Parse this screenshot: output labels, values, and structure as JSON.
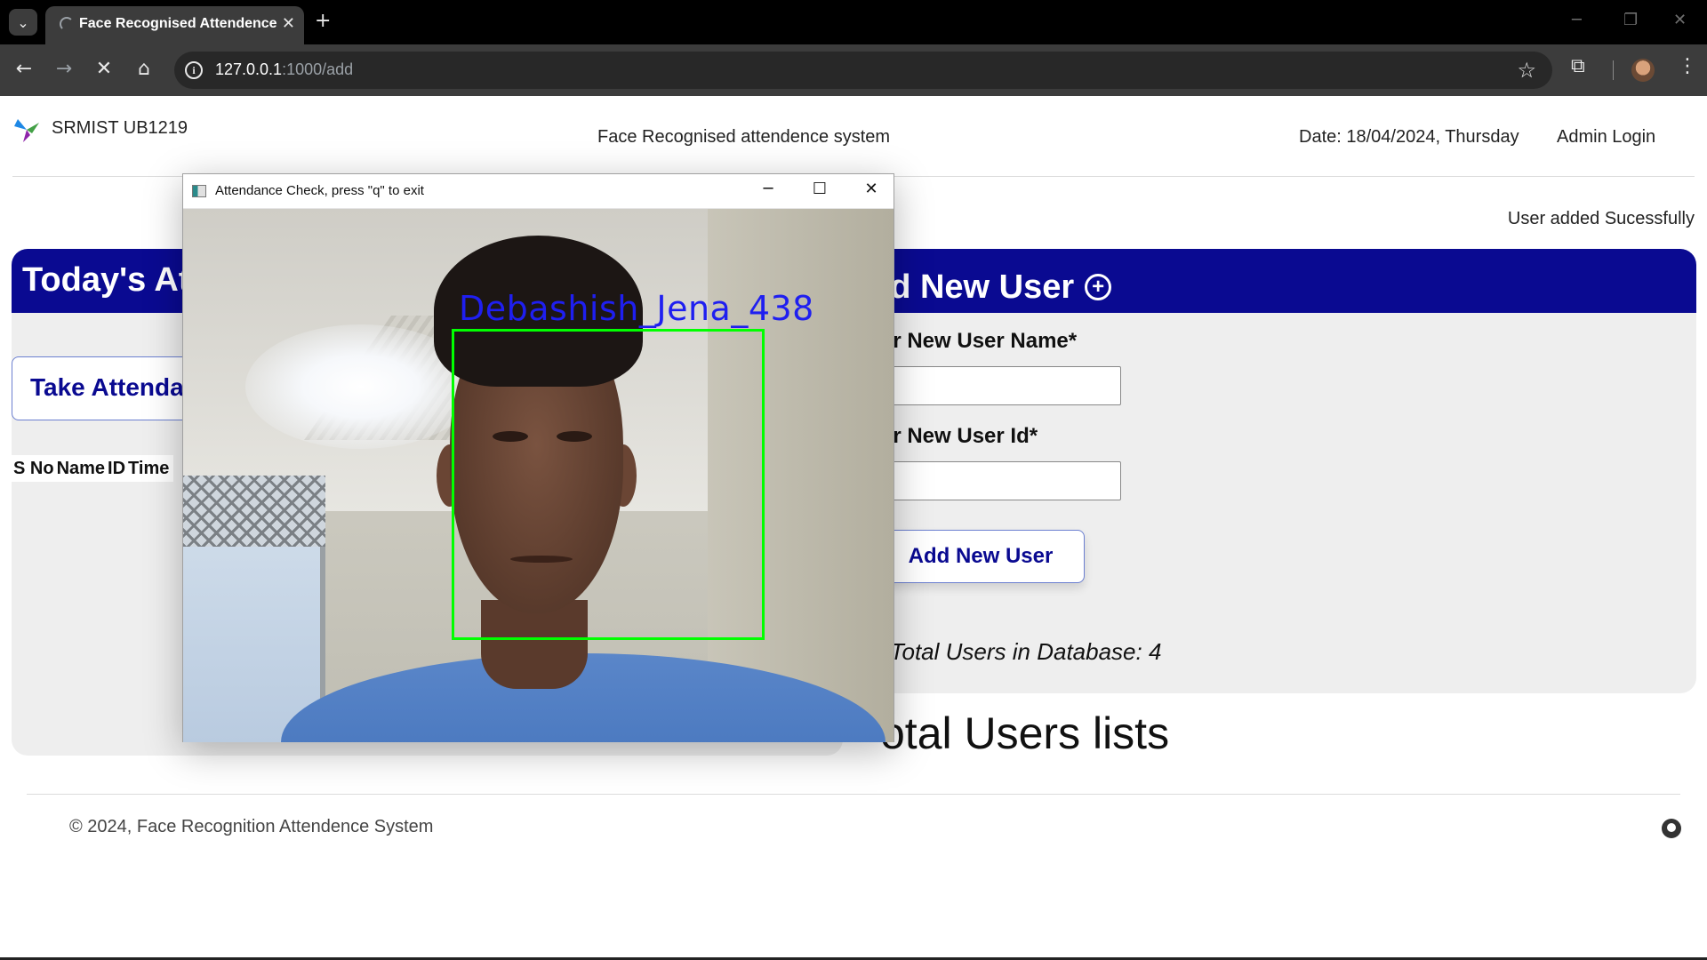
{
  "browser": {
    "tab_title": "Face Recognised Attendence",
    "url_host": "127.0.0.1",
    "url_rest": ":1000/add",
    "icons": {
      "tab_search": "chevron-down-icon",
      "close_tab": "close-icon",
      "new_tab": "plus-icon",
      "back": "arrow-left-icon",
      "forward": "arrow-right-icon",
      "stop": "close-icon",
      "home": "home-icon",
      "site_info": "info-icon",
      "bookmark": "star-icon",
      "extensions": "puzzle-icon",
      "profile": "avatar",
      "menu": "kebab-icon"
    }
  },
  "header": {
    "brand": "SRMIST UB1219",
    "title": "Face Recognised attendence system",
    "date": "Date: 18/04/2024, Thursday",
    "admin_link": "Admin Login"
  },
  "status_message": "User added Sucessfully",
  "attendance_panel": {
    "heading": "Today's At",
    "take_button": "Take Attenda",
    "columns": [
      "S No",
      "Name",
      "ID",
      "Time"
    ]
  },
  "add_user_panel": {
    "heading": "dd New User",
    "name_label": "ter New User Name*",
    "name_value": "",
    "id_label": "ter New User Id*",
    "id_value": "",
    "submit_button": "Add New User",
    "total_users": "Total Users in Database: 4"
  },
  "users_list_title": "otal Users lists",
  "footer": {
    "copyright": "© 2024, Face Recognition Attendence System"
  },
  "camera_window": {
    "title": "Attendance Check, press \"q\" to exit",
    "detected_label": "Debashish_Jena_438",
    "box_color": "#00ff00",
    "label_color": "#1f1ff0"
  },
  "colors": {
    "panel_header": "#0a0a91",
    "panel_bg": "#eeeeee"
  }
}
